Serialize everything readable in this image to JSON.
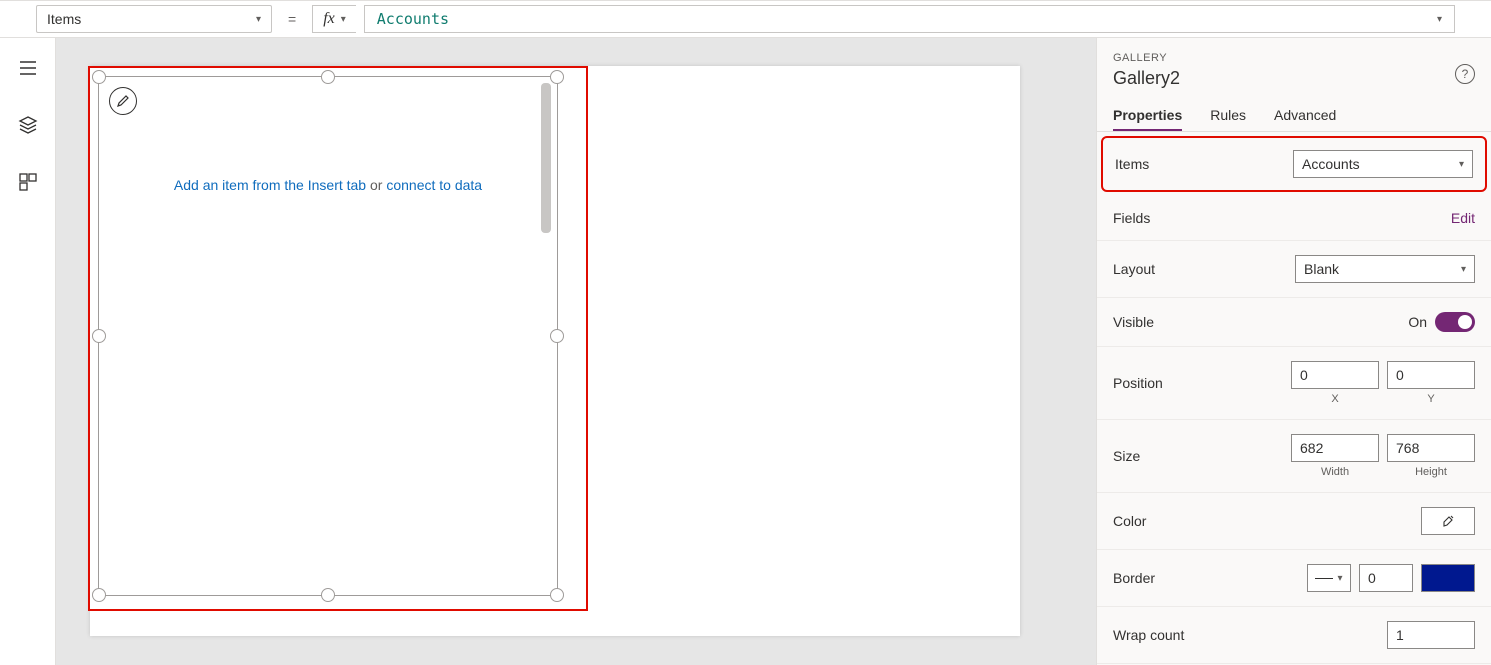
{
  "formulaBar": {
    "property": "Items",
    "equals": "=",
    "fx": "fx",
    "expression": "Accounts"
  },
  "canvas": {
    "hint_prefix": "Add an item from the Insert tab",
    "hint_mid": " or ",
    "hint_link": "connect to data"
  },
  "panel": {
    "kind": "GALLERY",
    "title": "Gallery2",
    "tabs": {
      "properties": "Properties",
      "rules": "Rules",
      "advanced": "Advanced"
    },
    "items": {
      "label": "Items",
      "value": "Accounts"
    },
    "fields": {
      "label": "Fields",
      "action": "Edit"
    },
    "layout": {
      "label": "Layout",
      "value": "Blank"
    },
    "visible": {
      "label": "Visible",
      "state": "On"
    },
    "position": {
      "label": "Position",
      "x": "0",
      "y": "0",
      "xlabel": "X",
      "ylabel": "Y"
    },
    "size": {
      "label": "Size",
      "w": "682",
      "h": "768",
      "wlabel": "Width",
      "hlabel": "Height"
    },
    "color": {
      "label": "Color"
    },
    "border": {
      "label": "Border",
      "width": "0",
      "fill": "#00188f"
    },
    "wrap": {
      "label": "Wrap count",
      "value": "1"
    }
  }
}
